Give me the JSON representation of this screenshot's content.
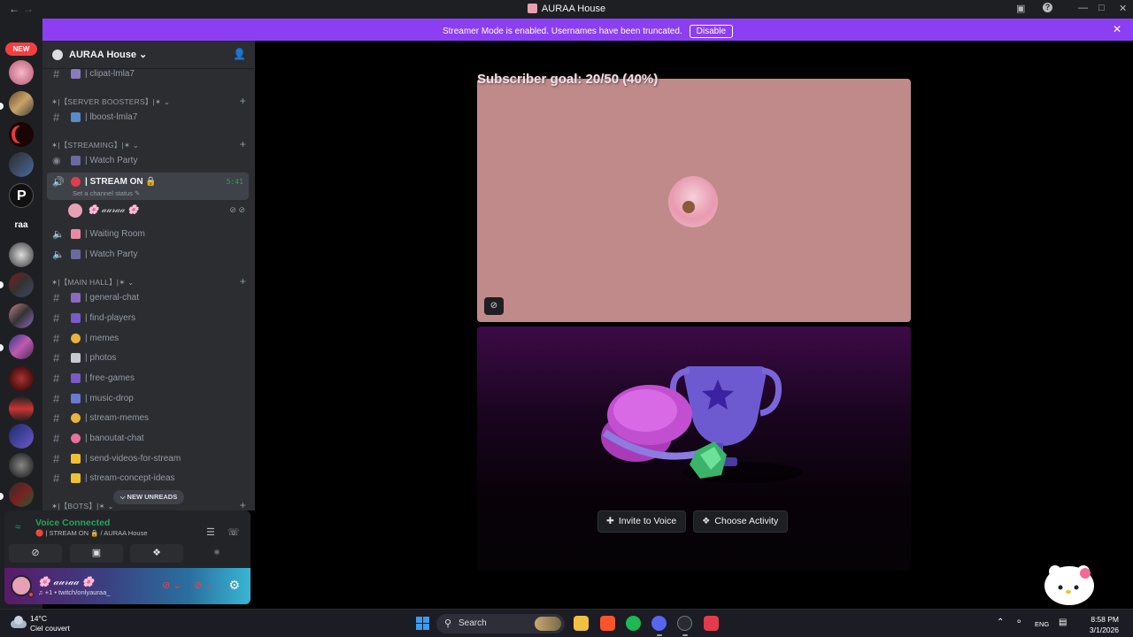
{
  "window": {
    "title": "AURAA House",
    "back_icon": "arrow-left-icon",
    "forward_icon": "arrow-right-icon"
  },
  "rail": {
    "new_badge": "NEW",
    "text_server": "raa"
  },
  "banner": {
    "message": "Streamer Mode is enabled. Usernames have been truncated.",
    "disable_label": "Disable",
    "color": "#8c3ff2"
  },
  "server": {
    "name": "AURAA House"
  },
  "channels": {
    "clipat": "| clipat-lmla7",
    "cat_boosters": "✶|【SERVER BOOSTERS】|✶",
    "lboost": "| lboost-lmla7",
    "cat_streaming": "✶|【STREAMING】|✶",
    "watch_party_1": "| Watch Party",
    "stream_on": "| STREAM ON 🔒",
    "stream_time": "5:41",
    "channel_status": "Set a channel status ✎",
    "member_name": "🌸 𝒶𝓊𝓇𝒶𝒶 🌸",
    "waiting_room": "| Waiting Room",
    "watch_party_2": "| Watch Party",
    "cat_main_hall": "✶|【MAIN HALL】|✶",
    "general_chat": "| general-chat",
    "find_players": "| find-players",
    "memes": "| memes",
    "photos": "| photos",
    "free_games": "| free-games",
    "music_drop": "| music-drop",
    "stream_memes": "| stream-memes",
    "banoutat_chat": "| banoutat-chat",
    "send_videos": "| send-videos-for-stream",
    "stream_concept": "| stream-concept-ideas",
    "cat_bots": "✶|【BOTS】|✶",
    "new_unreads": "⌵ NEW UNREADS"
  },
  "voice": {
    "status": "Voice Connected",
    "location": "🔴 | STREAM ON 🔒 / AURAA House",
    "status_color": "#23a55a"
  },
  "user": {
    "name": "🌸 𝒶𝓊𝓇𝒶𝒶 🌸",
    "sub": "♫ +1 • twitch/onlyauraa_"
  },
  "stage": {
    "overlay_title": "Subscriber goal: 20/50 (40%)",
    "invite_label": "Invite to Voice",
    "choose_activity_label": "Choose Activity",
    "tile_color": "#bf8a89"
  },
  "taskbar": {
    "temperature": "14°C",
    "condition": "Ciel couvert",
    "search_label": "Search",
    "language": "ENG",
    "time": "8:58 PM",
    "date": "3/1/2026"
  }
}
